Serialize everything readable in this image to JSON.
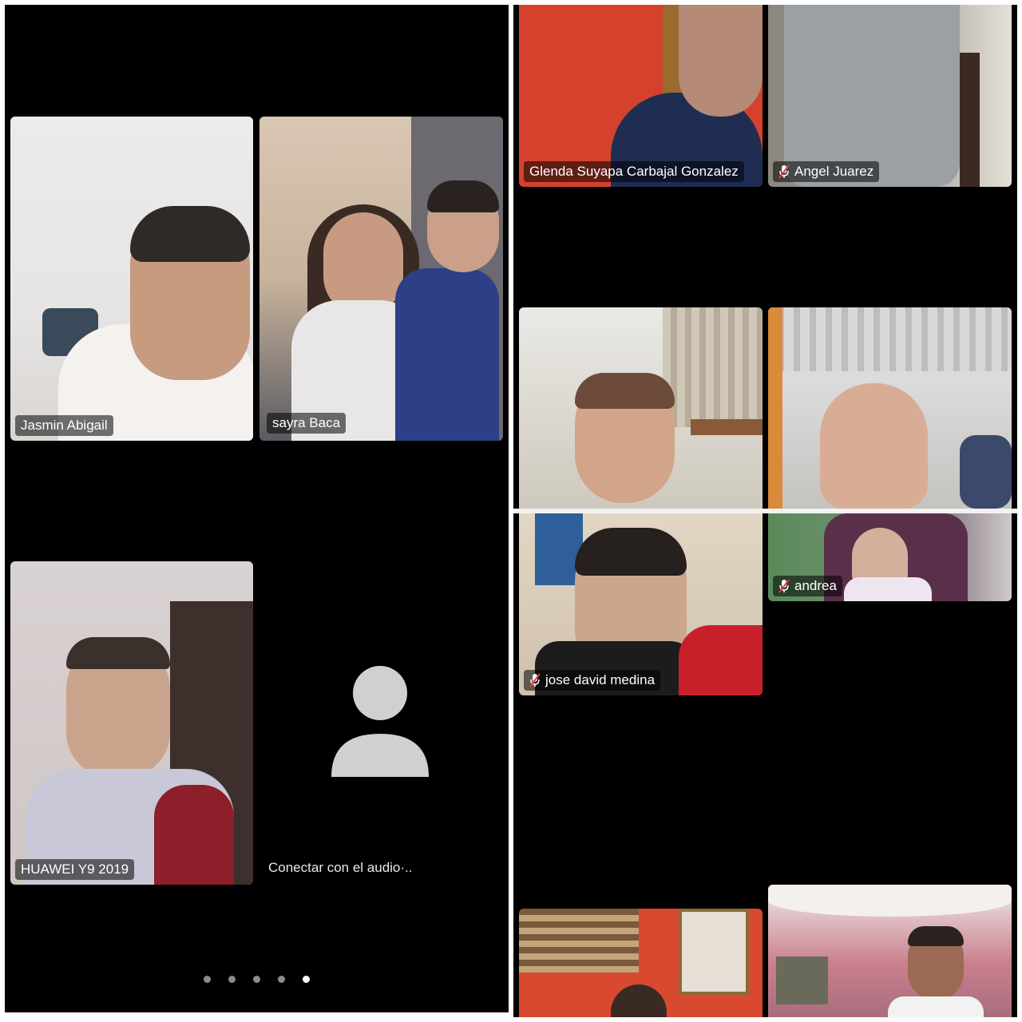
{
  "left_page": {
    "tiles": [
      {
        "name": "Jasmin Abigail",
        "muted": false,
        "active": false
      },
      {
        "name": "sayra Baca",
        "muted": false,
        "active": true
      },
      {
        "name": "HUAWEI Y9 2019",
        "muted": false,
        "active": false
      }
    ],
    "avatar_tile": {
      "label": "Conectar con el audio·..",
      "icon": "person-avatar-icon"
    },
    "pager": {
      "count": 5,
      "current": 5
    }
  },
  "right_page": {
    "tiles": [
      {
        "name": "Glenda Suyapa Carbajal Gonzalez",
        "muted": false
      },
      {
        "name": "Angel Juarez",
        "muted": true
      },
      {
        "name": "",
        "muted": false
      },
      {
        "name": "",
        "muted": false
      },
      {
        "name": "jose david medina",
        "muted": true
      },
      {
        "name": "andrea",
        "muted": true
      },
      {
        "name": "",
        "muted": false
      },
      {
        "name": "",
        "muted": false
      }
    ]
  },
  "colors": {
    "background": "#000000",
    "active_speaker": "#3ccf4e",
    "label_bg": "rgba(0,0,0,0.55)"
  }
}
